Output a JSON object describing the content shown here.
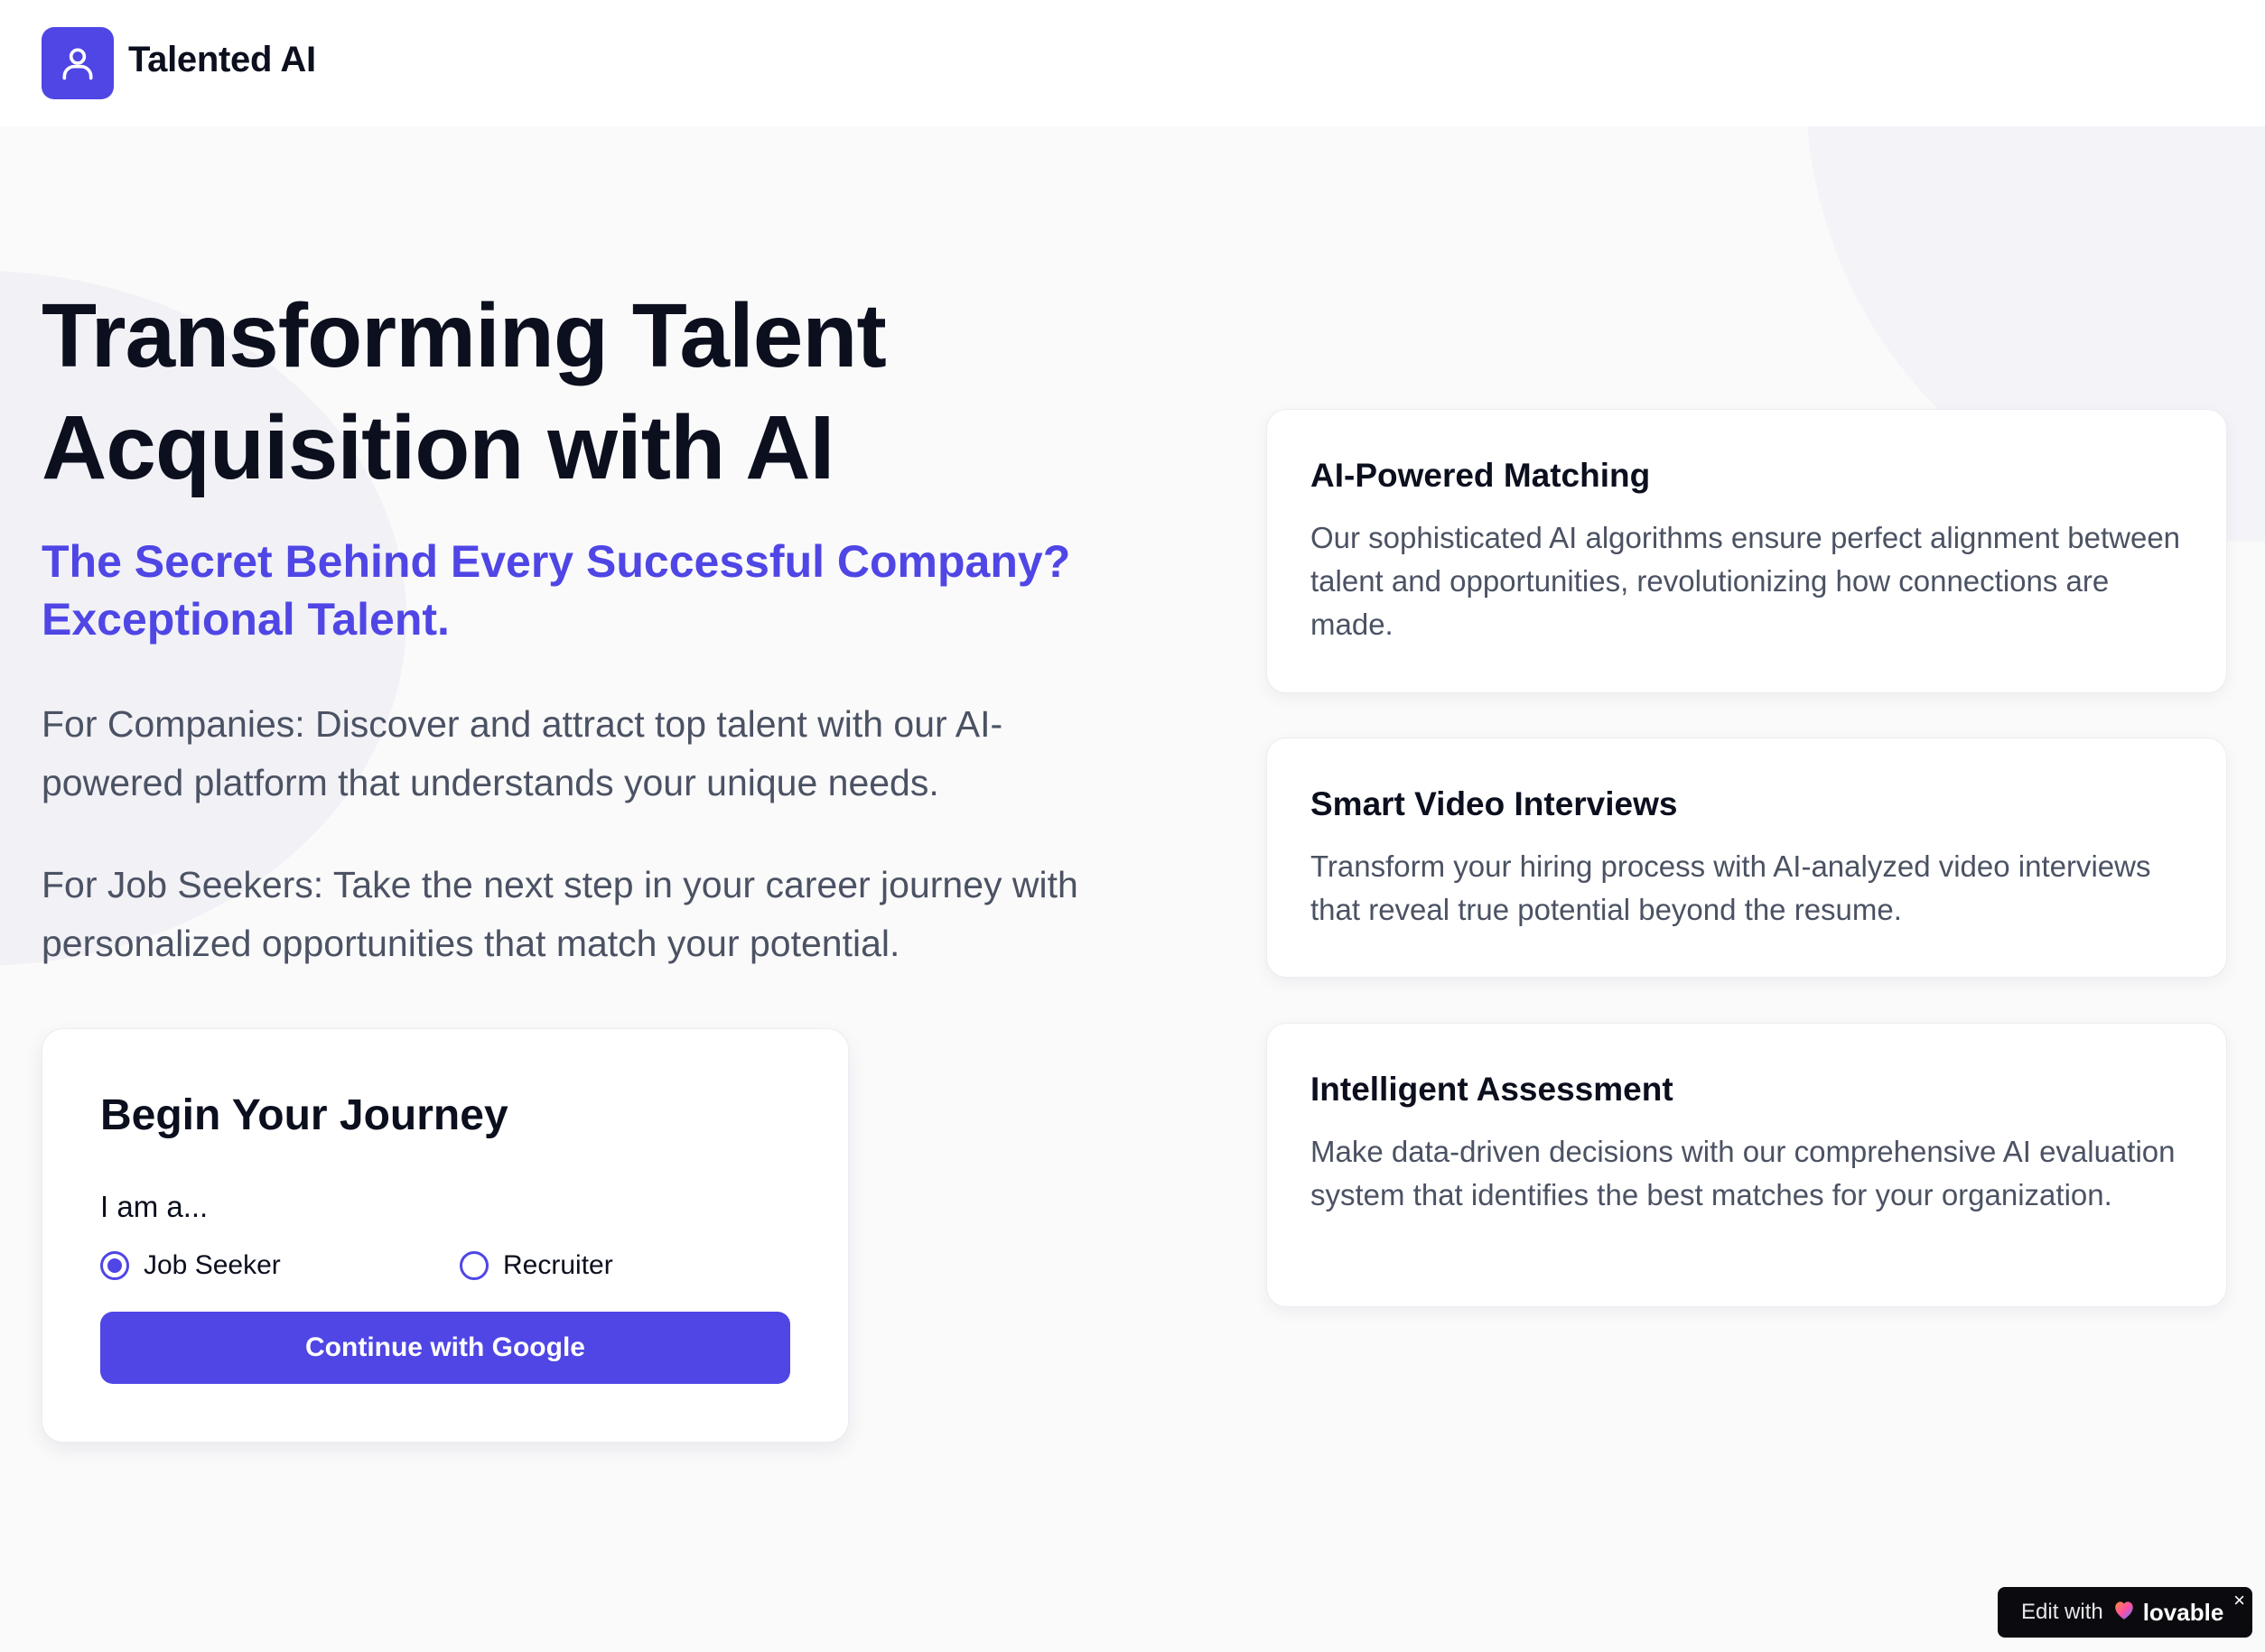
{
  "header": {
    "brand": "Talented AI",
    "logo_icon": "user-icon"
  },
  "hero": {
    "title": "Transforming Talent Acquisition with AI",
    "subtitle": "The Secret Behind Every Successful Company? Exceptional Talent.",
    "para_companies": "For Companies: Discover and attract top talent with our AI-powered platform that understands your unique needs.",
    "para_seekers": "For Job Seekers: Take the next step in your career journey with personalized opportunities that match your potential."
  },
  "journey": {
    "title": "Begin Your Journey",
    "role_label": "I am a...",
    "options": [
      {
        "label": "Job Seeker",
        "selected": true
      },
      {
        "label": "Recruiter",
        "selected": false
      }
    ],
    "button_label": "Continue with Google"
  },
  "features": [
    {
      "title": "AI-Powered Matching",
      "description": "Our sophisticated AI algorithms ensure perfect alignment between talent and opportunities, revolutionizing how connections are made."
    },
    {
      "title": "Smart Video Interviews",
      "description": "Transform your hiring process with AI-analyzed video interviews that reveal true potential beyond the resume."
    },
    {
      "title": "Intelligent Assessment",
      "description": "Make data-driven decisions with our comprehensive AI evaluation system that identifies the best matches for your organization."
    }
  ],
  "badge": {
    "prefix": "Edit with",
    "brand": "lovable",
    "close": "×"
  },
  "colors": {
    "accent": "#4f46e5",
    "heading": "#0b0f1e",
    "body_text": "#4b5263",
    "background": "#fafafb"
  }
}
